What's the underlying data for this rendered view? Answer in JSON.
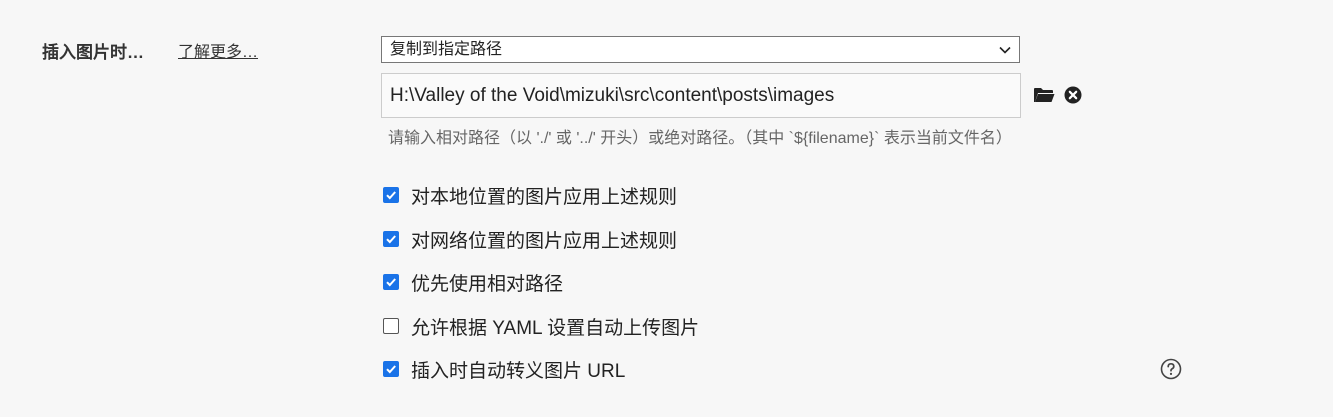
{
  "setting": {
    "label": "插入图片时…",
    "learn_more": "了解更多…",
    "action_select": {
      "selected": "复制到指定路径"
    },
    "path_input": {
      "value": "H:\\Valley of the Void\\mizuki\\src\\content\\posts\\images"
    },
    "hint": "请输入相对路径（以 './' 或 '../' 开头）或绝对路径。（其中 `${filename}` 表示当前文件名）",
    "icons": {
      "folder": "folder-icon",
      "clear": "clear-circle-icon",
      "help": "help-circle-icon"
    },
    "options": [
      {
        "label": "对本地位置的图片应用上述规则",
        "checked": true
      },
      {
        "label": "对网络位置的图片应用上述规则",
        "checked": true
      },
      {
        "label": "优先使用相对路径",
        "checked": true
      },
      {
        "label": "允许根据 YAML 设置自动上传图片",
        "checked": false
      },
      {
        "label": "插入时自动转义图片 URL",
        "checked": true
      }
    ]
  },
  "colors": {
    "accent": "#1a73e8",
    "background": "#f7f7f7"
  }
}
